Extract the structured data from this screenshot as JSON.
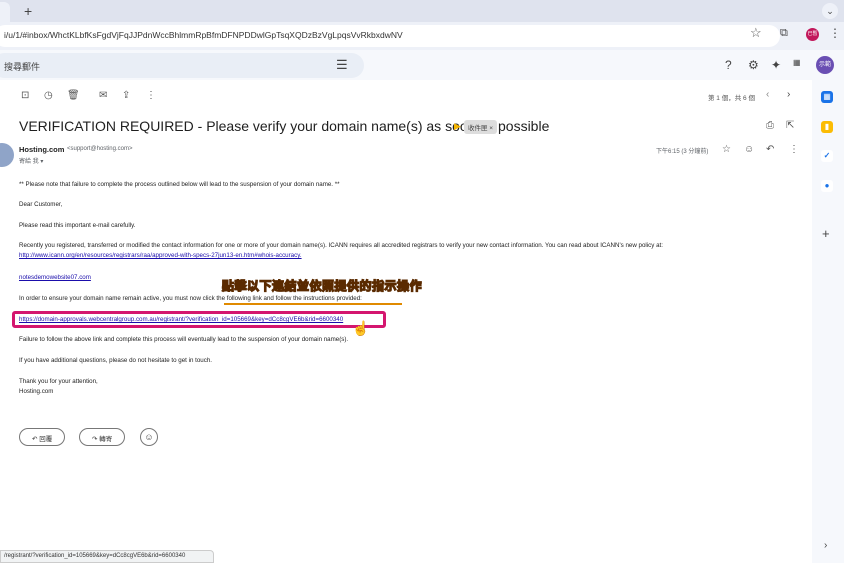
{
  "browser": {
    "tab_close": "×",
    "tab_new": "+",
    "tab_menu": "⌄",
    "url": "i/u/1/#inbox/WhctKLbfKsFgdVjFqJJPdnWccBhlmmRpBfmDFNPDDwlGpTsqXQDzBzVgLpqsVvRkbxdwNV",
    "profile_label": "已暫",
    "star": "☆",
    "extension": "⧉",
    "menu": "⋮"
  },
  "gmail": {
    "search_placeholder": "搜尋郵件",
    "filter_icon": "⚙",
    "help_icon": "?",
    "settings_icon": "⚙",
    "gemini_icon": "✦",
    "apps_icon": "⋮⋮⋮",
    "avatar_label": "示範",
    "toolbar": {
      "archive": "⊡",
      "snooze": "◷",
      "delete": "🗑",
      "mark_unread": "✉",
      "move": "⇪",
      "more": "⋮"
    },
    "pager_text": "第 1 個，共 6 個",
    "pager_prev": "‹",
    "pager_next": "›"
  },
  "email": {
    "subject": "VERIFICATION REQUIRED - Please verify your domain name(s) as soon as possible",
    "label": "收件匣 ×",
    "sender_name": "Hosting.com",
    "sender_email": "<support@hosting.com>",
    "to": "寄給 我 ▾",
    "time": "下午6:15 (3 分鐘前)",
    "body": {
      "notice": "** Please note that failure to complete the process outlined below will lead to the suspension of your domain name. **",
      "greeting": "Dear Customer,",
      "read_carefully": "Please read this important e-mail carefully.",
      "recently": "Recently you registered, transferred or modified the contact information for one or more of your domain name(s). ICANN requires all accredited registrars to verify your new contact information. You can read about ICANN's new policy at:",
      "icann_link": "http://www.icann.org/en/resources/registrars/raa/approved-with-specs-27jun13-en.htm#whois-accuracy.",
      "domain": "notesdemowebsite07.com",
      "ensure_prefix": "In order to ensure your domain name remain active, you must now ",
      "ensure_highlight": "click the following link and follow the instructions provided:",
      "verify_link": "https://domain-approvals.webcentralgroup.com.au/registrant/?verification_id=105669&key=dCc8cgVE6b&rid=6600340",
      "failure": "Failure to follow the above link and complete this process will eventually lead to the suspension of your domain name(s).",
      "questions": "If you have additional questions, please do not hesitate to get in touch.",
      "thanks": "Thank you for your attention,",
      "signature": "Hosting.com"
    },
    "reply_label": "↶  回覆",
    "forward_label": "↷  轉寄",
    "emoji": "☺"
  },
  "overlay_caption": "點擊以下連結並依照提供的指示操作",
  "status_bar": "/registrant/?verification_id=105669&key=dCc8cgVE6b&rid=6600340",
  "side_panel": {
    "calendar": "▦",
    "keep": "▮",
    "tasks": "✓",
    "contacts": "●",
    "add": "+",
    "expand": "›"
  }
}
